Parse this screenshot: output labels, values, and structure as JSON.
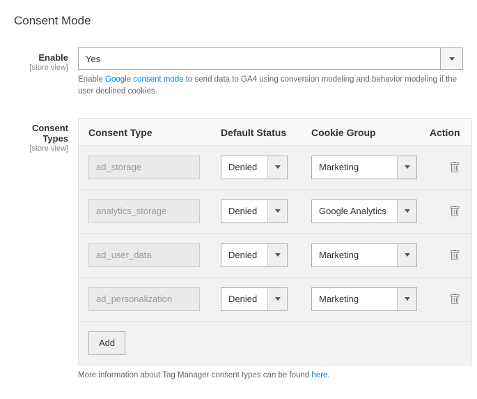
{
  "section": {
    "title": "Consent Mode"
  },
  "enable": {
    "label": "Enable",
    "scope": "[store view]",
    "value": "Yes",
    "note_pre": "Enable ",
    "note_link": "Google consent mode",
    "note_post": " to send data to GA4 using conversion modeling and behavior modeling if the user declined cookies."
  },
  "consentTypes": {
    "label": "Consent Types",
    "scope": "[store view]",
    "headers": {
      "type": "Consent Type",
      "status": "Default Status",
      "group": "Cookie Group",
      "action": "Action"
    },
    "rows": [
      {
        "type": "ad_storage",
        "status": "Denied",
        "group": "Marketing"
      },
      {
        "type": "analytics_storage",
        "status": "Denied",
        "group": "Google Analytics"
      },
      {
        "type": "ad_user_data",
        "status": "Denied",
        "group": "Marketing"
      },
      {
        "type": "ad_personalization",
        "status": "Denied",
        "group": "Marketing"
      }
    ],
    "addLabel": "Add",
    "footer_pre": "More information about Tag Manager consent types can be found ",
    "footer_link": "here",
    "footer_post": "."
  }
}
